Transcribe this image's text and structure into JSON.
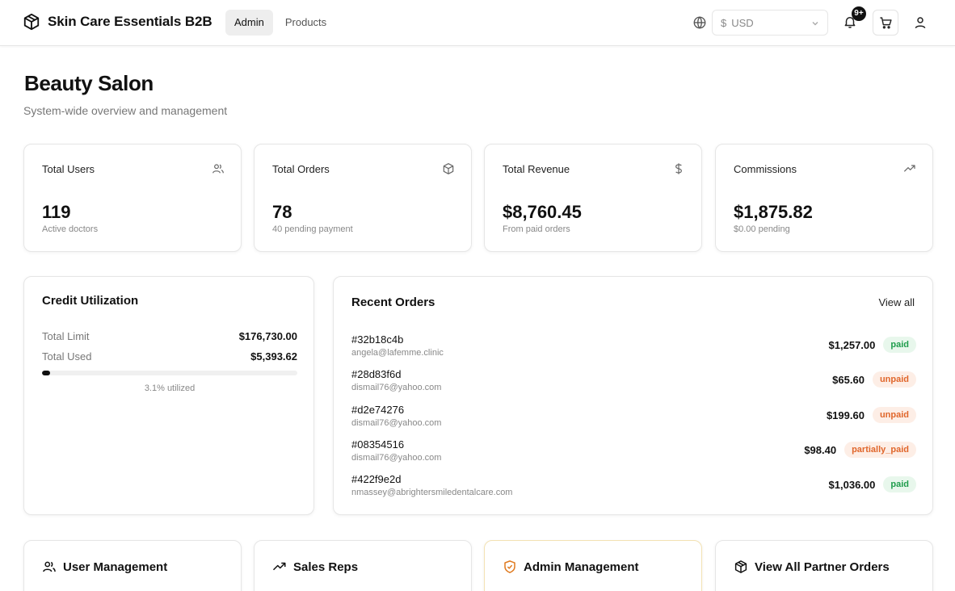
{
  "header": {
    "brand_icon": "package-icon",
    "brand_title": "Skin Care Essentials B2B",
    "tabs": [
      {
        "label": "Admin",
        "active": true
      },
      {
        "label": "Products",
        "active": false
      }
    ],
    "currency": {
      "symbol": "$",
      "value": "USD"
    },
    "notifications_badge": "9+"
  },
  "page": {
    "title": "Beauty Salon",
    "subtitle": "System-wide overview and management"
  },
  "stats": [
    {
      "label": "Total Users",
      "icon": "users-icon",
      "value": "119",
      "sub": "Active doctors"
    },
    {
      "label": "Total Orders",
      "icon": "package-icon",
      "value": "78",
      "sub": "40 pending payment"
    },
    {
      "label": "Total Revenue",
      "icon": "dollar-icon",
      "value": "$8,760.45",
      "sub": "From paid orders"
    },
    {
      "label": "Commissions",
      "icon": "trending-up-icon",
      "value": "$1,875.82",
      "sub": "$0.00 pending"
    }
  ],
  "credit": {
    "title": "Credit Utilization",
    "total_limit_label": "Total Limit",
    "total_limit_value": "$176,730.00",
    "total_used_label": "Total Used",
    "total_used_value": "$5,393.62",
    "utilized_fraction": 0.031,
    "utilized_text": "3.1% utilized"
  },
  "recent_orders": {
    "title": "Recent Orders",
    "view_all": "View all",
    "orders": [
      {
        "id": "#32b18c4b",
        "email": "angela@lafemme.clinic",
        "amount": "$1,257.00",
        "status": "paid"
      },
      {
        "id": "#28d83f6d",
        "email": "dismail76@yahoo.com",
        "amount": "$65.60",
        "status": "unpaid"
      },
      {
        "id": "#d2e74276",
        "email": "dismail76@yahoo.com",
        "amount": "$199.60",
        "status": "unpaid"
      },
      {
        "id": "#08354516",
        "email": "dismail76@yahoo.com",
        "amount": "$98.40",
        "status": "partially_paid"
      },
      {
        "id": "#422f9e2d",
        "email": "nmassey@abrightersmiledentalcare.com",
        "amount": "$1,036.00",
        "status": "paid"
      }
    ]
  },
  "status_colors": {
    "paid": {
      "bg": "#e8f7ec",
      "fg": "#1f9d4c"
    },
    "unpaid": {
      "bg": "#fdeee6",
      "fg": "#e0662b"
    },
    "partially_paid": {
      "bg": "#fdeee6",
      "fg": "#e0662b"
    }
  },
  "nav_cards": [
    {
      "label": "User Management",
      "icon": "users-icon",
      "highlight": false
    },
    {
      "label": "Sales Reps",
      "icon": "trending-up-icon",
      "highlight": false
    },
    {
      "label": "Admin Management",
      "icon": "shield-icon",
      "highlight": true
    },
    {
      "label": "View All Partner Orders",
      "icon": "package-icon",
      "highlight": false
    }
  ],
  "colors": {
    "highlight_border": "#f3e2b3",
    "shield_icon": "#e07a1f"
  }
}
